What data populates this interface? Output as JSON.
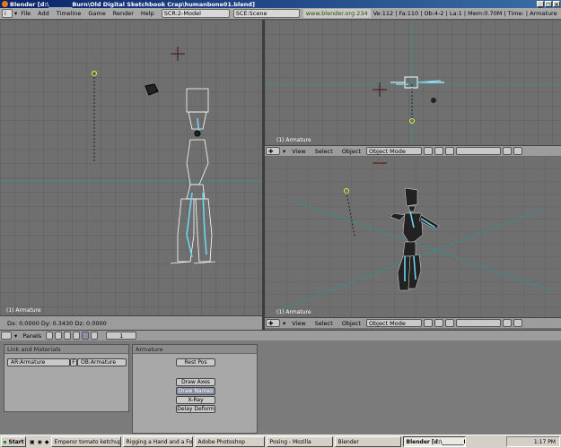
{
  "window": {
    "title": "Blender [d:\\________Burn\\Old Digital Sketchbook Crap\\humanbone01.blend]",
    "controls": [
      "_",
      "□",
      "×"
    ]
  },
  "info_header": {
    "menus": [
      "File",
      "Add",
      "Timeline",
      "Game",
      "Render",
      "Help"
    ],
    "screen_field": "SCR:2-Model",
    "scene_field": "SCE:Scene",
    "website": "www.blender.org 234",
    "stats": "Ve:112 | Fa:110 | Ob:4-2 | La:1 | Mem:0.70M | Time: | Armature"
  },
  "viewport_left": {
    "label": "(1) Armature",
    "status": "Dx: 0.0000   Dy: 0.3430   Dz: 0.0000"
  },
  "viewport_top_right": {
    "label": "(1) Armature",
    "menus": [
      "View",
      "Select",
      "Object"
    ],
    "mode": "Object Mode"
  },
  "viewport_bottom_right": {
    "label": "(1) Armature",
    "menus": [
      "View",
      "Select",
      "Object"
    ],
    "mode": "Object Mode"
  },
  "buttons_window": {
    "panels_label": "Panels",
    "frame": "1",
    "link_panel": {
      "title": "Link and Materials",
      "ar_field": "AR:Armature",
      "f_label": "F",
      "ob_field": "OB:Armature"
    },
    "armature_panel": {
      "title": "Armature",
      "rest_pos": "Rest Pos",
      "draw_axes": "Draw Axes",
      "draw_names": "Draw Names",
      "xray": "X-Ray",
      "delay_deform": "Delay Deform"
    }
  },
  "taskbar": {
    "start": "Start",
    "tasks": [
      {
        "label": "Emperor tomato ketchup",
        "active": false
      },
      {
        "label": "Rigging a Hand and a Foo...",
        "active": false
      },
      {
        "label": "Adobe Photoshop",
        "active": false
      },
      {
        "label": "Posing - Mozilla",
        "active": false
      },
      {
        "label": "Blender",
        "active": false
      },
      {
        "label": "Blender [d:\\________Bu...",
        "active": true
      }
    ],
    "clock": "1:17 PM"
  },
  "colors": {
    "viewport_bg": "#6f6f6f",
    "bone_selected": "#6fd3f0",
    "title_bar": "#0a246a"
  },
  "icons": [
    "blender-icon",
    "cursor-3d-icon",
    "lamp-icon",
    "camera-icon",
    "view-menu-icon",
    "start-icon"
  ]
}
